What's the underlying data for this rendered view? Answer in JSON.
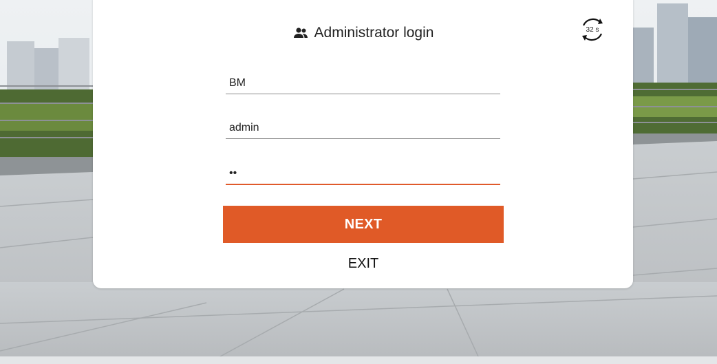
{
  "dialog": {
    "title": "Administrator login",
    "title_icon": "people-icon",
    "timer_text": "32 s",
    "timer_icon": "countdown-ring-icon"
  },
  "form": {
    "field_1_value": "BM",
    "field_2_value": "admin",
    "field_3_value": "••"
  },
  "actions": {
    "next_label": "NEXT",
    "exit_label": "EXIT"
  },
  "colors": {
    "accent": "#e05a27",
    "dialog_bg": "#ffffff"
  }
}
